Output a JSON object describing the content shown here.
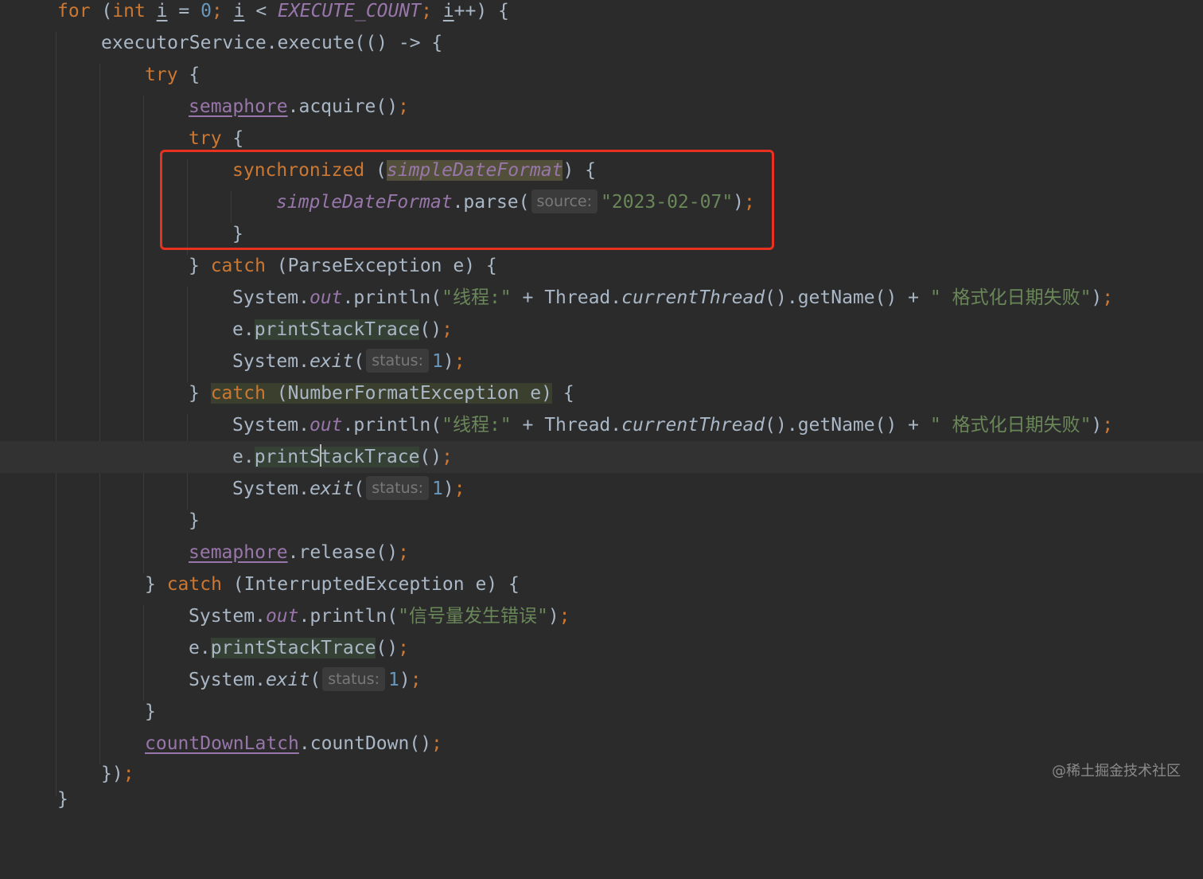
{
  "editor": {
    "language": "java",
    "lines": {
      "l1": {
        "for_kw": "for",
        "open": " (",
        "int_kw": "int",
        "var_i1": "i",
        "assign": " = ",
        "zero": "0",
        "semi1": ";",
        "var_i2": "i",
        "lt": " < ",
        "execute_count": "EXECUTE_COUNT",
        "semi2": ";",
        "var_i3": "i",
        "inc": "++) {"
      },
      "l2": {
        "text": "executorService.execute(() -> {"
      },
      "l3": {
        "try_kw": "try",
        "brace": " {"
      },
      "l4": {
        "semaphore": "semaphore",
        "call": ".acquire()",
        "semi": ";"
      },
      "l5": {
        "try_kw": "try",
        "brace": " {"
      },
      "l6": {
        "sync_kw": "synchronized",
        "open": " (",
        "sdf": "simpleDateFormat",
        "close": ") {"
      },
      "l7": {
        "sdf": "simpleDateFormat",
        "call": ".parse(",
        "hint": "source:",
        "date_str": "\"2023-02-07\"",
        "close": ")",
        "semi": ";"
      },
      "l8": {
        "brace": "}"
      },
      "l9": {
        "brace": "} ",
        "catch_kw": "catch",
        "rest": " (ParseException e) {"
      },
      "l10": {
        "system": "System.",
        "out": "out",
        "println": ".println(",
        "str1": "\"线程:\"",
        "plus1": " + Thread.",
        "current_thread": "currentThread",
        "getname": "().getName() + ",
        "str2": "\" 格式化日期失败\"",
        "close": ")",
        "semi": ";"
      },
      "l11": {
        "e_dot": "e.",
        "method": "printStackTrace",
        "call": "()",
        "semi": ";"
      },
      "l12": {
        "system": "System.",
        "exit": "exit",
        "open": "(",
        "hint": "status:",
        "one": "1",
        "close": ")",
        "semi": ";"
      },
      "l13": {
        "brace": "} ",
        "catch_kw": "catch",
        "rest": " (NumberFormatException e)",
        "brace_open": " {"
      },
      "l14": {
        "system": "System.",
        "out": "out",
        "println": ".println(",
        "str1": "\"线程:\"",
        "plus1": " + Thread.",
        "current_thread": "currentThread",
        "getname": "().getName() + ",
        "str2": "\" 格式化日期失败\"",
        "close": ")",
        "semi": ";"
      },
      "l15": {
        "e_dot": "e.",
        "method_before_caret": "printS",
        "method_after_caret": "tackTrace",
        "call": "()",
        "semi": ";"
      },
      "l16": {
        "system": "System.",
        "exit": "exit",
        "open": "(",
        "hint": "status:",
        "one": "1",
        "close": ")",
        "semi": ";"
      },
      "l17": {
        "brace": "}"
      },
      "l18": {
        "semaphore": "semaphore",
        "call": ".release()",
        "semi": ";"
      },
      "l19": {
        "brace": "} ",
        "catch_kw": "catch",
        "rest": " (InterruptedException e) {"
      },
      "l20": {
        "system": "System.",
        "out": "out",
        "println": ".println(",
        "str": "\"信号量发生错误\"",
        "close": ")",
        "semi": ";"
      },
      "l21": {
        "e_dot": "e.",
        "method": "printStackTrace",
        "call": "()",
        "semi": ";"
      },
      "l22": {
        "system": "System.",
        "exit": "exit",
        "open": "(",
        "hint": "status:",
        "one": "1",
        "close": ")",
        "semi": ";"
      },
      "l23": {
        "brace": "}"
      },
      "l24": {
        "latch": "countDownLatch",
        "call": ".countDown()",
        "semi": ";"
      },
      "l25": {
        "close": "})",
        "semi": ";"
      },
      "l26": {
        "brace": "}"
      }
    }
  },
  "annotation": {
    "color": "#e8321f"
  },
  "watermark": {
    "text": "@稀土掘金技术社区"
  },
  "colors": {
    "background": "#2b2b2b",
    "keyword": "#cc7832",
    "number": "#6897bb",
    "string": "#6a8759",
    "field": "#9876aa",
    "text": "#a9b7c6"
  }
}
